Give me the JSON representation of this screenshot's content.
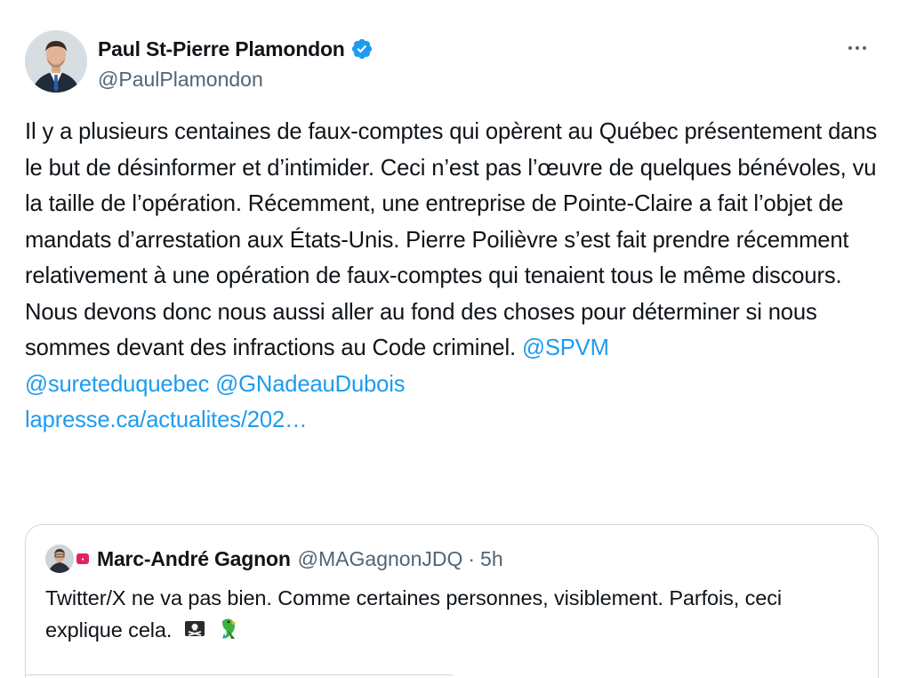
{
  "author": {
    "display_name": "Paul St-Pierre Plamondon",
    "handle": "@PaulPlamondon",
    "verified": true,
    "avatar_icon": "profile-photo"
  },
  "tweet": {
    "text": "Il y a plusieurs centaines de faux-comptes qui opèrent au Québec présentement dans le but de désinformer et d’intimider. Ceci n’est pas l’œuvre de quelques bénévoles, vu la taille de l’opération. Récemment, une entreprise de Pointe-Claire a fait l’objet de mandats d’arrestation aux États-Unis. Pierre Poilièvre s’est fait prendre récemment relativement à une opération de faux-comptes qui tenaient tous le même discours. Nous devons donc nous aussi aller au fond des choses pour déterminer si nous sommes devant des infractions au Code criminel.",
    "mentions": [
      "@SPVM",
      "@sureteduquebec",
      "@GNadeauDubois"
    ],
    "link": "lapresse.ca/actualites/202…"
  },
  "quote": {
    "display_name": "Marc-André Gagnon",
    "handle": "@MAGagnonJDQ",
    "separator": "·",
    "time": "5h",
    "text": "Twitter/X ne va pas bien. Comme certaines personnes, visiblement. Parfois, ceci explique cela.",
    "emojis": [
      "pirate-flag-emoji",
      "parrot-emoji"
    ]
  },
  "colors": {
    "link": "#1d9bf0",
    "secondary_text": "#536471",
    "border": "#cfd9de",
    "verified": "#1d9bf0"
  }
}
